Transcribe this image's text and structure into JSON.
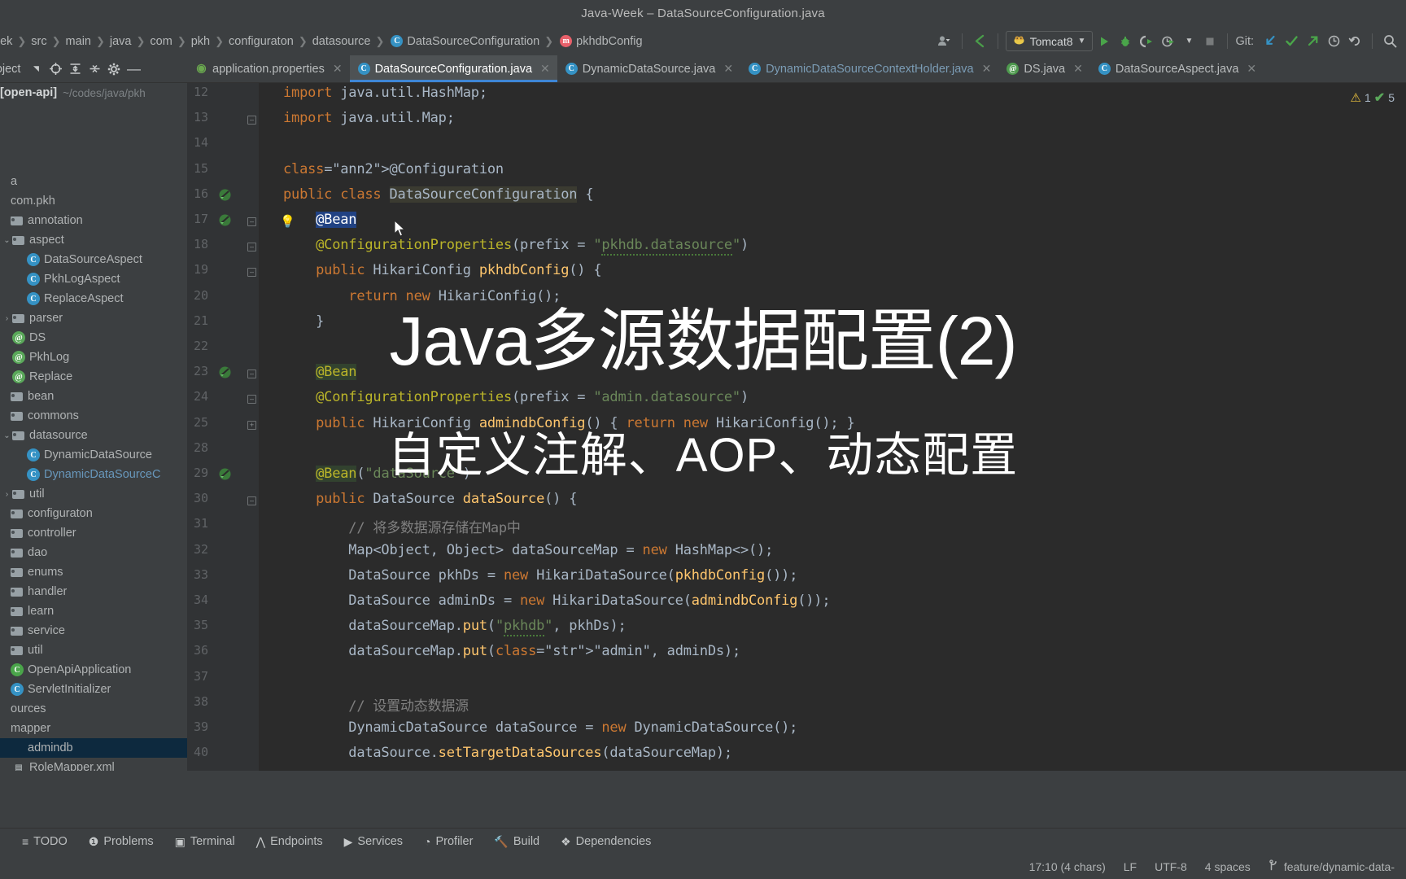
{
  "window": {
    "title": "Java-Week – DataSourceConfiguration.java"
  },
  "breadcrumb": {
    "items": [
      {
        "label": "eek",
        "icon": null
      },
      {
        "label": "src",
        "icon": null
      },
      {
        "label": "main",
        "icon": null
      },
      {
        "label": "java",
        "icon": null
      },
      {
        "label": "com",
        "icon": null
      },
      {
        "label": "pkh",
        "icon": null
      },
      {
        "label": "configuraton",
        "icon": null
      },
      {
        "label": "datasource",
        "icon": null
      },
      {
        "label": "DataSourceConfiguration",
        "icon": "class-icon"
      },
      {
        "label": "pkhdbConfig",
        "icon": "method-icon"
      }
    ]
  },
  "toolbar": {
    "profile_icon": "user-profile-icon",
    "back_icon": "back-arrow-icon",
    "run_config": {
      "label": "Tomcat8",
      "icon": "tomcat-icon",
      "dropdown_icon": "chevron-down-icon"
    },
    "run_icon": "run-play-icon",
    "debug_icon": "debug-bug-icon",
    "run_coverage_icon": "run-with-coverage-icon",
    "profile_run_icon": "profiler-run-icon",
    "stop_icon": "stop-square-icon",
    "git_label": "Git:",
    "git_update_icon": "git-update-project-icon",
    "git_commit_icon": "git-commit-checkmark-icon",
    "git_push_icon": "git-push-arrow-icon",
    "git_history_icon": "git-history-clock-icon",
    "git_rollback_icon": "git-rollback-icon",
    "search_icon": "search-everywhere-icon"
  },
  "project_panel": {
    "title": "roject",
    "icons": [
      "collapse-dropdown-icon",
      "locate-target-icon",
      "expand-all-icon",
      "collapse-all-icon",
      "settings-gear-icon",
      "hide-panel-icon"
    ]
  },
  "editor_tabs": [
    {
      "label": "application.properties",
      "icon": "properties-file-icon",
      "active": false,
      "dim": false
    },
    {
      "label": "DataSourceConfiguration.java",
      "icon": "class-icon",
      "active": true,
      "dim": false
    },
    {
      "label": "DynamicDataSource.java",
      "icon": "class-icon",
      "active": false,
      "dim": false
    },
    {
      "label": "DynamicDataSourceContextHolder.java",
      "icon": "class-icon",
      "active": false,
      "dim": true
    },
    {
      "label": "DS.java",
      "icon": "annotation-icon",
      "active": false,
      "dim": false
    },
    {
      "label": "DataSourceAspect.java",
      "icon": "class-icon",
      "active": false,
      "dim": false
    }
  ],
  "sidebar": {
    "root": {
      "label": "[open-api]",
      "path": "~/codes/java/pkh"
    },
    "items": [
      {
        "label": "a",
        "indent": 0,
        "icon": "none",
        "arrow": "",
        "selected": false
      },
      {
        "label": "com.pkh",
        "indent": 0,
        "icon": "none",
        "arrow": "",
        "selected": false
      },
      {
        "label": "annotation",
        "indent": 0,
        "icon": "folder",
        "arrow": "",
        "selected": false
      },
      {
        "label": "aspect",
        "indent": 1,
        "icon": "folder",
        "arrow": "v",
        "selected": false
      },
      {
        "label": "DataSourceAspect",
        "indent": 2,
        "icon": "class",
        "arrow": "",
        "selected": false
      },
      {
        "label": "PkhLogAspect",
        "indent": 2,
        "icon": "class",
        "arrow": "",
        "selected": false
      },
      {
        "label": "ReplaceAspect",
        "indent": 2,
        "icon": "class",
        "arrow": "",
        "selected": false
      },
      {
        "label": "parser",
        "indent": 1,
        "icon": "folder",
        "arrow": ">",
        "selected": false
      },
      {
        "label": "DS",
        "indent": 1,
        "icon": "annotation",
        "arrow": "",
        "selected": false
      },
      {
        "label": "PkhLog",
        "indent": 1,
        "icon": "annotation",
        "arrow": "",
        "selected": false
      },
      {
        "label": "Replace",
        "indent": 1,
        "icon": "annotation",
        "arrow": "",
        "selected": false
      },
      {
        "label": "bean",
        "indent": 0,
        "icon": "folder",
        "arrow": "",
        "selected": false
      },
      {
        "label": "commons",
        "indent": 0,
        "icon": "folder",
        "arrow": "",
        "selected": false
      },
      {
        "label": "datasource",
        "indent": 1,
        "icon": "folder",
        "arrow": "v",
        "selected": false
      },
      {
        "label": "DynamicDataSource",
        "indent": 2,
        "icon": "class",
        "arrow": "",
        "selected": false
      },
      {
        "label": "DynamicDataSourceC",
        "indent": 2,
        "icon": "class",
        "arrow": "",
        "selected": false,
        "blue": true
      },
      {
        "label": "util",
        "indent": 1,
        "icon": "folder",
        "arrow": ">",
        "selected": false
      },
      {
        "label": "configuraton",
        "indent": 0,
        "icon": "folder",
        "arrow": "",
        "selected": false
      },
      {
        "label": "controller",
        "indent": 0,
        "icon": "folder",
        "arrow": "",
        "selected": false
      },
      {
        "label": "dao",
        "indent": 0,
        "icon": "folder",
        "arrow": "",
        "selected": false
      },
      {
        "label": "enums",
        "indent": 0,
        "icon": "folder",
        "arrow": "",
        "selected": false
      },
      {
        "label": "handler",
        "indent": 0,
        "icon": "folder",
        "arrow": "",
        "selected": false
      },
      {
        "label": "learn",
        "indent": 0,
        "icon": "folder",
        "arrow": "",
        "selected": false
      },
      {
        "label": "service",
        "indent": 0,
        "icon": "folder",
        "arrow": "",
        "selected": false
      },
      {
        "label": "util",
        "indent": 0,
        "icon": "folder",
        "arrow": "",
        "selected": false
      },
      {
        "label": "OpenApiApplication",
        "indent": 0,
        "icon": "spring",
        "arrow": "",
        "selected": false
      },
      {
        "label": "ServletInitializer",
        "indent": 0,
        "icon": "class",
        "arrow": "",
        "selected": false
      },
      {
        "label": "ources",
        "indent": 0,
        "icon": "none",
        "arrow": "",
        "selected": false
      },
      {
        "label": "mapper",
        "indent": 0,
        "icon": "none",
        "arrow": "",
        "selected": false
      },
      {
        "label": "admindb",
        "indent": 0,
        "icon": "folderblue",
        "arrow": "",
        "selected": true
      },
      {
        "label": "RoleMapper.xml",
        "indent": 1,
        "icon": "xml",
        "arrow": "",
        "selected": false
      }
    ]
  },
  "editor": {
    "inspections": {
      "warning_count": "1",
      "ok_count": "5",
      "warning_icon": "warning-triangle-icon",
      "ok_icon": "green-check-icon"
    },
    "lines": [
      {
        "n": "12",
        "text": "import java.util.HashMap;"
      },
      {
        "n": "13",
        "text": "import java.util.Map;"
      },
      {
        "n": "14",
        "text": ""
      },
      {
        "n": "15",
        "text": "@Configuration"
      },
      {
        "n": "16",
        "text": "public class DataSourceConfiguration {"
      },
      {
        "n": "17",
        "text": "    @Bean"
      },
      {
        "n": "18",
        "text": "    @ConfigurationProperties(prefix = \"pkhdb.datasource\")"
      },
      {
        "n": "19",
        "text": "    public HikariConfig pkhdbConfig() {"
      },
      {
        "n": "20",
        "text": "        return new HikariConfig();"
      },
      {
        "n": "21",
        "text": "    }"
      },
      {
        "n": "22",
        "text": ""
      },
      {
        "n": "23",
        "text": "    @Bean"
      },
      {
        "n": "24",
        "text": "    @ConfigurationProperties(prefix = \"admin.datasource\")"
      },
      {
        "n": "25",
        "text": "    public HikariConfig admindbConfig() { return new HikariConfig(); }"
      },
      {
        "n": "28",
        "text": ""
      },
      {
        "n": "29",
        "text": "    @Bean(\"dataSource\")"
      },
      {
        "n": "30",
        "text": "    public DataSource dataSource() {"
      },
      {
        "n": "31",
        "text": "        // 将多数据源存储在Map中"
      },
      {
        "n": "32",
        "text": "        Map<Object, Object> dataSourceMap = new HashMap<>();"
      },
      {
        "n": "33",
        "text": "        DataSource pkhDs = new HikariDataSource(pkhdbConfig());"
      },
      {
        "n": "34",
        "text": "        DataSource adminDs = new HikariDataSource(admindbConfig());"
      },
      {
        "n": "35",
        "text": "        dataSourceMap.put(\"pkhdb\", pkhDs);"
      },
      {
        "n": "36",
        "text": "        dataSourceMap.put(\"admin\", adminDs);"
      },
      {
        "n": "37",
        "text": ""
      },
      {
        "n": "38",
        "text": "        // 设置动态数据源"
      },
      {
        "n": "39",
        "text": "        DynamicDataSource dataSource = new DynamicDataSource();"
      },
      {
        "n": "40",
        "text": "        dataSource.setTargetDataSources(dataSourceMap);"
      }
    ]
  },
  "overlay": {
    "title": "Java多源数据配置(2)",
    "subtitle": "自定义注解、AOP、动态配置"
  },
  "bottom_tools": [
    {
      "label": "TODO",
      "icon": "todo-list-icon"
    },
    {
      "label": "Problems",
      "icon": "problems-warning-icon"
    },
    {
      "label": "Terminal",
      "icon": "terminal-icon"
    },
    {
      "label": "Endpoints",
      "icon": "endpoints-icon"
    },
    {
      "label": "Services",
      "icon": "services-play-icon"
    },
    {
      "label": "Profiler",
      "icon": "profiler-icon"
    },
    {
      "label": "Build",
      "icon": "build-hammer-icon"
    },
    {
      "label": "Dependencies",
      "icon": "dependencies-icon"
    }
  ],
  "statusbar": {
    "caret": "17:10 (4 chars)",
    "line_separator": "LF",
    "encoding": "UTF-8",
    "indent": "4 spaces",
    "branch": "feature/dynamic-data-",
    "branch_icon": "git-branch-icon"
  },
  "colors": {
    "panel_bg": "#3c3f41",
    "editor_bg": "#2b2b2b",
    "gutter_bg": "#313335",
    "accent_blue": "#3e86d6",
    "selection_blue": "#214283",
    "selected_row": "#0d293e",
    "keyword_orange": "#cc7832",
    "annotation_yellow": "#bbb529",
    "string_green": "#6a8759",
    "method_gold": "#ffc66d",
    "comment_gray": "#808080",
    "text_default": "#a9b7c6"
  }
}
